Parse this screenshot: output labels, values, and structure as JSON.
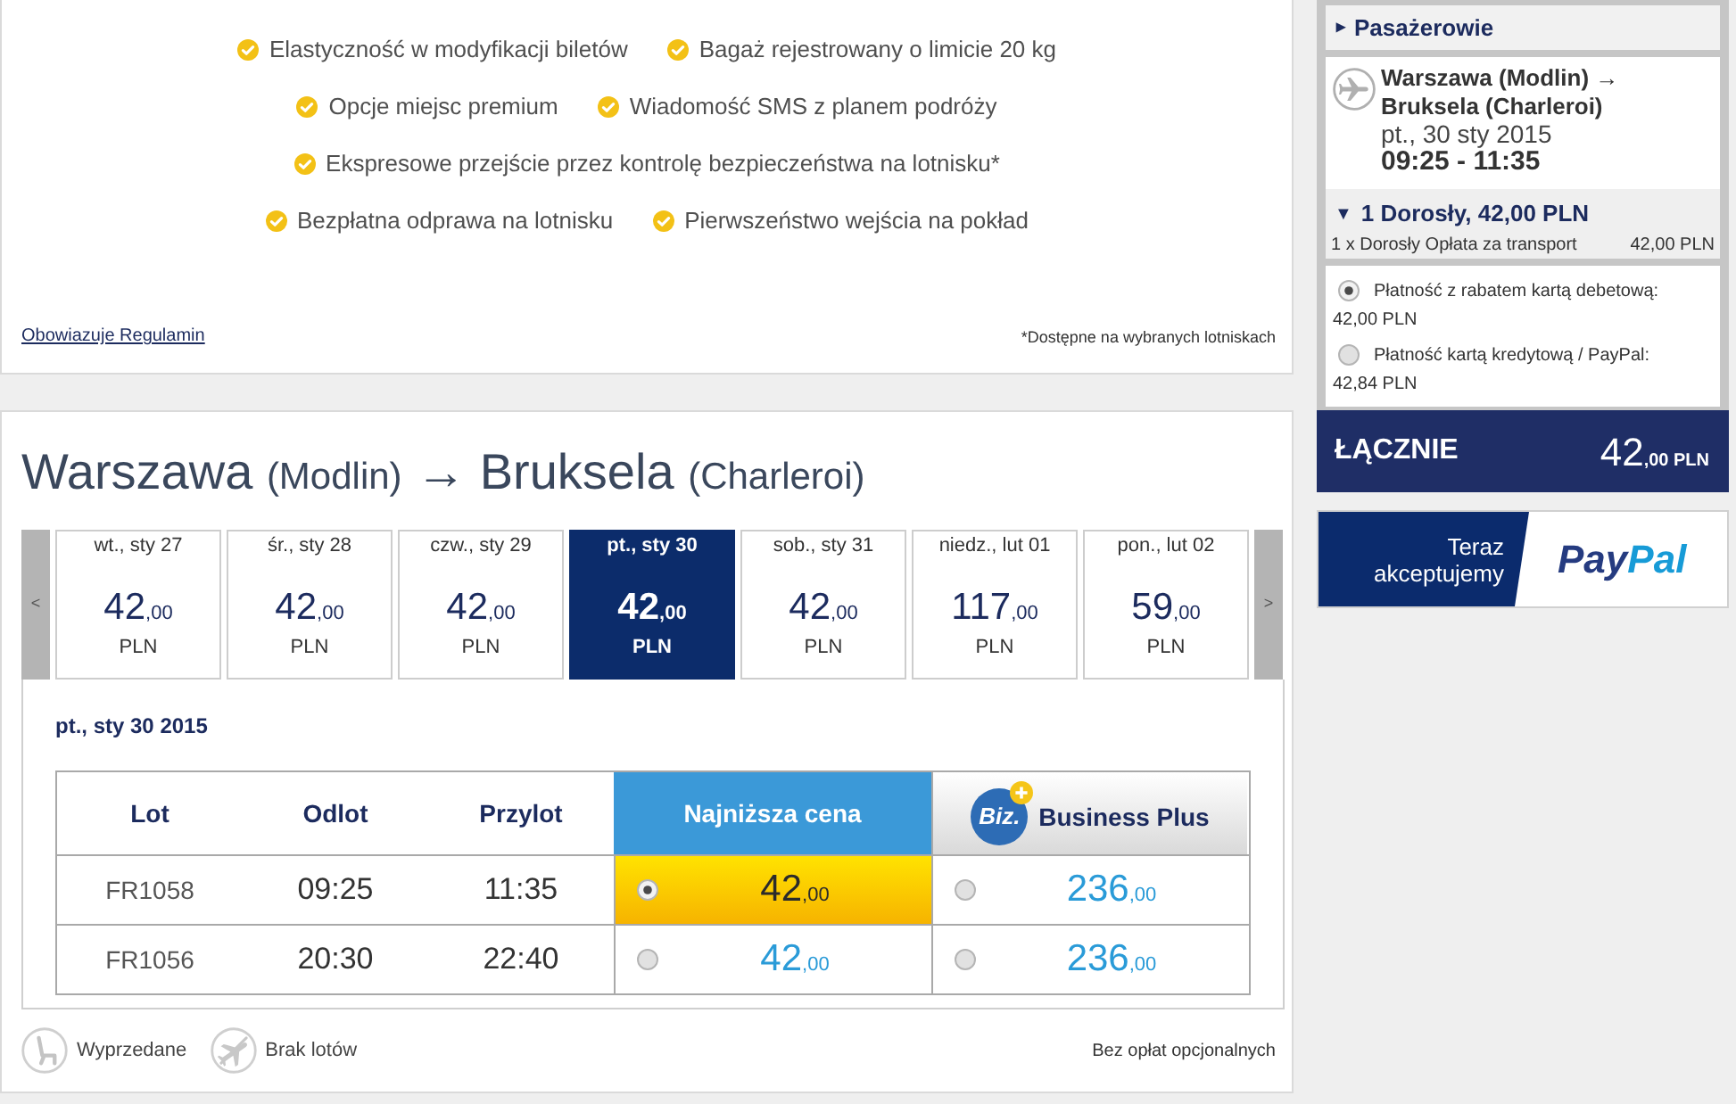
{
  "features": {
    "rows": [
      [
        "Elastyczność w modyfikacji biletów",
        "Bagaż rejestrowany o limicie 20 kg"
      ],
      [
        "Opcje miejsc premium",
        "Wiadomość SMS z planem podróży"
      ],
      [
        "Ekspresowe przejście przez kontrolę bezpieczeństwa na lotnisku*"
      ],
      [
        "Bezpłatna odprawa na lotnisku",
        "Pierwszeństwo wejścia na pokład"
      ]
    ],
    "terms_link": "Obowiazuje Regulamin",
    "footnote": "*Dostępne na wybranych lotniskach"
  },
  "route": {
    "origin": "Warszawa",
    "origin_airport": "(Modlin)",
    "arrow": "→",
    "destination": "Bruksela",
    "destination_airport": "(Charleroi)"
  },
  "date_strip": {
    "prev": "<",
    "next": ">",
    "days": [
      {
        "label": "wt., sty 27",
        "amount": "42",
        "decimals": ",00",
        "currency": "PLN",
        "selected": false
      },
      {
        "label": "śr., sty 28",
        "amount": "42",
        "decimals": ",00",
        "currency": "PLN",
        "selected": false
      },
      {
        "label": "czw., sty 29",
        "amount": "42",
        "decimals": ",00",
        "currency": "PLN",
        "selected": false
      },
      {
        "label": "pt., sty 30",
        "amount": "42",
        "decimals": ",00",
        "currency": "PLN",
        "selected": true
      },
      {
        "label": "sob., sty 31",
        "amount": "42",
        "decimals": ",00",
        "currency": "PLN",
        "selected": false
      },
      {
        "label": "niedz., lut 01",
        "amount": "117",
        "decimals": ",00",
        "currency": "PLN",
        "selected": false
      },
      {
        "label": "pon., lut 02",
        "amount": "59",
        "decimals": ",00",
        "currency": "PLN",
        "selected": false
      }
    ]
  },
  "flights": {
    "date": "pt., sty 30 2015",
    "columns": [
      {
        "label": "Lot",
        "kind": "plain"
      },
      {
        "label": "Odlot",
        "kind": "plain"
      },
      {
        "label": "Przylot",
        "kind": "plain"
      },
      {
        "label": "Najniższa cena",
        "kind": "lowest"
      },
      {
        "label": "Business Plus",
        "kind": "business",
        "badge": "Biz."
      }
    ],
    "rows": [
      {
        "flight": "FR1058",
        "departure": "09:25",
        "arrival": "11:35",
        "fares": [
          {
            "amount": "42",
            "decimals": ",00",
            "selected": true
          },
          {
            "amount": "236",
            "decimals": ",00",
            "selected": false
          }
        ]
      },
      {
        "flight": "FR1056",
        "departure": "20:30",
        "arrival": "22:40",
        "fares": [
          {
            "amount": "42",
            "decimals": ",00",
            "selected": false
          },
          {
            "amount": "236",
            "decimals": ",00",
            "selected": false
          }
        ]
      }
    ]
  },
  "legend": {
    "items": [
      {
        "kind": "sold_out",
        "label": "Wyprzedane"
      },
      {
        "kind": "no_flights",
        "label": "Brak lotów"
      }
    ],
    "note": "Bez opłat opcjonalnych"
  },
  "sidebar": {
    "passengers": {
      "marker": "▸",
      "title": "Pasażerowie"
    },
    "trip": {
      "route_line_1": "Warszawa (Modlin) →",
      "route_line_2": "Bruksela (Charleroi)",
      "date": "pt., 30 sty 2015",
      "times": "09:25 - 11:35"
    },
    "fare_summary": {
      "marker": "▼",
      "title": "1 Dorosły, 42,00 PLN",
      "line_label": "1 x Dorosły Opłata za transport",
      "line_amount": "42,00 PLN"
    },
    "payment_options": [
      {
        "label": "Płatność z rabatem kartą debetową:",
        "amount": "42,00 PLN",
        "selected": true
      },
      {
        "label": "Płatność kartą kredytową / PayPal:",
        "amount": "42,84 PLN",
        "selected": false
      }
    ],
    "total": {
      "label": "ŁĄCZNIE",
      "amount": "42",
      "decimals": ",00",
      "currency": "PLN"
    },
    "paypal_banner": {
      "text": "Teraz akceptujemy",
      "logo": [
        {
          "text": "Pay",
          "color": "#253b80"
        },
        {
          "text": "Pal",
          "color": "#179bd7"
        }
      ]
    }
  }
}
